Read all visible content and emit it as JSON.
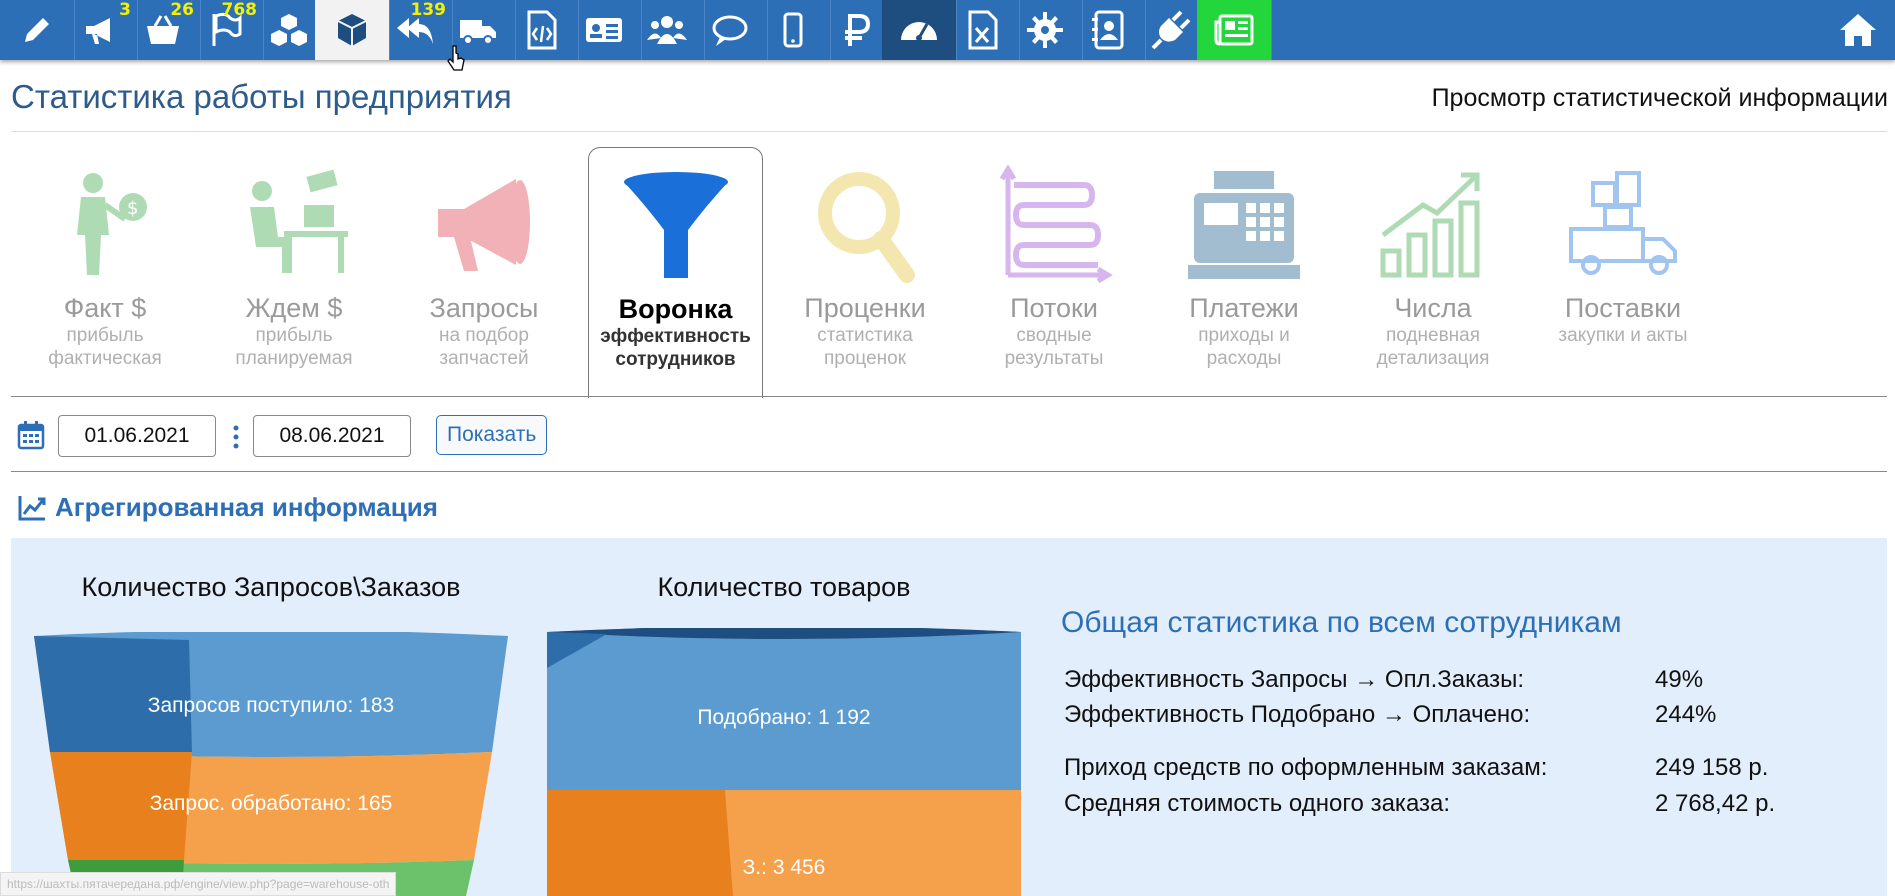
{
  "toolbar": {
    "badges": {
      "announcements": "3",
      "cart": "26",
      "flags": "768",
      "replies": "139"
    }
  },
  "page": {
    "title": "Статистика работы предприятия",
    "subtitle": "Просмотр статистической информации"
  },
  "tabs": [
    {
      "title": "Факт $",
      "line1": "прибыль",
      "line2": "фактическая"
    },
    {
      "title": "Ждем $",
      "line1": "прибыль",
      "line2": "планируемая"
    },
    {
      "title": "Запросы",
      "line1": "на подбор",
      "line2": "запчастей"
    },
    {
      "title": "Воронка",
      "line1": "эффективность",
      "line2": "сотрудников"
    },
    {
      "title": "Проценки",
      "line1": "статистика",
      "line2": "проценок"
    },
    {
      "title": "Потоки",
      "line1": "сводные",
      "line2": "результаты"
    },
    {
      "title": "Платежи",
      "line1": "приходы и",
      "line2": "расходы"
    },
    {
      "title": "Числа",
      "line1": "подневная",
      "line2": "детализация"
    },
    {
      "title": "Поставки",
      "line1": "закупки и акты",
      "line2": ""
    }
  ],
  "filter": {
    "date_from": "01.06.2021",
    "date_to": "08.06.2021",
    "show_label": "Показать"
  },
  "section": {
    "title": "Агрегированная информация"
  },
  "funnels": {
    "requests": {
      "title": "Количество Запросов\\Заказов",
      "stage1": "Запросов поступило: 183",
      "stage2": "Запрос. обработано: 165"
    },
    "goods": {
      "title": "Количество товаров",
      "stage1": "Подобрано: 1 192",
      "stage2": "З.: 3 456"
    }
  },
  "stats": {
    "title": "Общая статистика по всем сотрудникам",
    "rows": [
      {
        "label": "Эффективность Запросы → Опл.Заказы:",
        "value": "49%"
      },
      {
        "label": "Эффективность Подобрано → Оплачено:",
        "value": "244%"
      },
      {
        "label": "Приход средств по оформленным заказам:",
        "value": "249 158 р."
      },
      {
        "label": "Средняя стоимость одного заказа:",
        "value": "2 768,42 р."
      }
    ]
  },
  "statusbar": {
    "url": "https://шахты.пятачередана.рф/engine/view.php?page=warehouse-oth"
  },
  "colors": {
    "toolbar": "#2d6fb6",
    "accent": "#2d6fb6",
    "panel": "#e2eefb",
    "funnel_blue": "#5b9bd0",
    "funnel_orange": "#f5a04a",
    "funnel_green": "#6cc26a"
  }
}
